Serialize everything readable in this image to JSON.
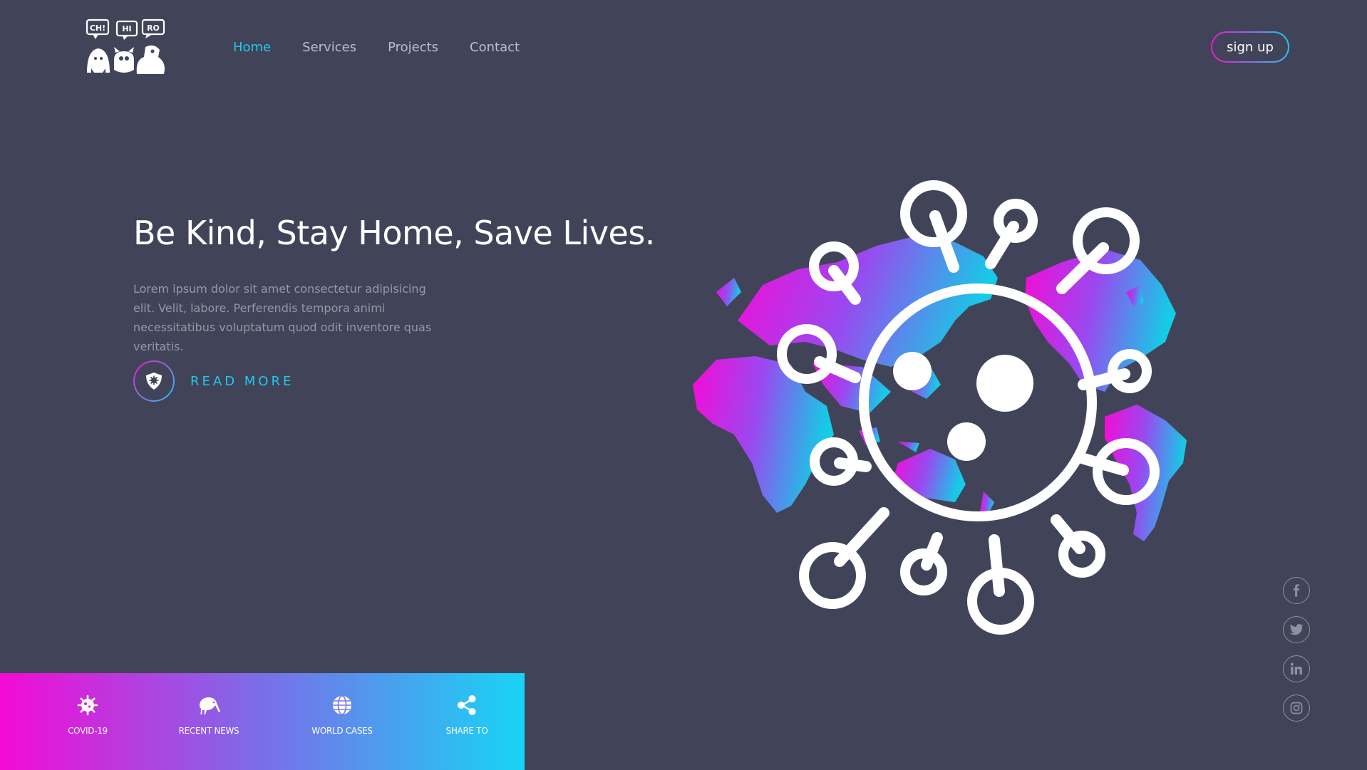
{
  "logo": {
    "bubbles": [
      "CH!",
      "HI",
      "RO"
    ]
  },
  "nav": {
    "items": [
      {
        "label": "Home",
        "active": true
      },
      {
        "label": "Services",
        "active": false
      },
      {
        "label": "Projects",
        "active": false
      },
      {
        "label": "Contact",
        "active": false
      }
    ]
  },
  "header": {
    "signup_label": "sign up"
  },
  "hero": {
    "title": "Be Kind, Stay Home, Save Lives.",
    "body": "Lorem ipsum dolor sit amet consectetur adipisicing elit. Velit, labore. Perferendis tempora animi necessitatibus voluptatum quod odit inventore quas veritatis.",
    "read_more_label": "READ MORE"
  },
  "bottom_bar": {
    "items": [
      {
        "label": "COVID-19",
        "icon": "virus-icon"
      },
      {
        "label": "RECENT NEWS",
        "icon": "kiwi-bird-icon"
      },
      {
        "label": "WORLD CASES",
        "icon": "globe-icon"
      },
      {
        "label": "SHARE TO",
        "icon": "share-icon"
      }
    ]
  },
  "socials": [
    {
      "name": "facebook",
      "icon": "facebook-icon"
    },
    {
      "name": "twitter",
      "icon": "twitter-icon"
    },
    {
      "name": "linkedin",
      "icon": "linkedin-icon"
    },
    {
      "name": "instagram",
      "icon": "instagram-icon"
    }
  ],
  "colors": {
    "background": "#414459",
    "accent": "#21c8ec",
    "magenta": "#f412d5"
  }
}
